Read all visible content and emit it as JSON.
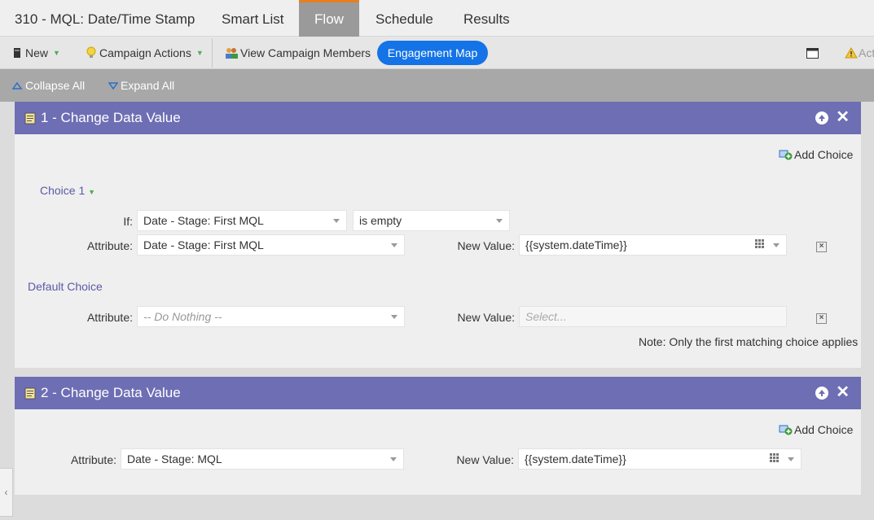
{
  "tabs": [
    {
      "label": "310 - MQL: Date/Time Stamp"
    },
    {
      "label": "Smart List"
    },
    {
      "label": "Flow"
    },
    {
      "label": "Schedule"
    },
    {
      "label": "Results"
    }
  ],
  "toolbar": {
    "new_label": "New",
    "campaign_actions_label": "Campaign Actions",
    "view_members_label": "View Campaign Members",
    "engagement_map_label": "Engagement Map",
    "right_truncated_label": "Act"
  },
  "collapse": {
    "collapse_all": "Collapse All",
    "expand_all": "Expand All"
  },
  "flow_steps": [
    {
      "title": "1 - Change Data Value",
      "add_choice": "Add Choice",
      "choice_label": "Choice 1",
      "if_label": "If:",
      "if_field": "Date - Stage: First MQL",
      "if_operator": "is empty",
      "attribute_label": "Attribute:",
      "attribute_value": "Date - Stage: First MQL",
      "new_value_label": "New Value:",
      "new_value": "{{system.dateTime}}",
      "default_choice_label": "Default Choice",
      "default_attribute_label": "Attribute:",
      "default_attribute_value": "-- Do Nothing --",
      "default_new_value_label": "New Value:",
      "default_new_value_placeholder": "Select...",
      "note": "Note: Only the first matching choice applies"
    },
    {
      "title": "2 - Change Data Value",
      "add_choice": "Add Choice",
      "attribute_label": "Attribute:",
      "attribute_value": "Date - Stage: MQL",
      "new_value_label": "New Value:",
      "new_value": "{{system.dateTime}}"
    }
  ],
  "colors": {
    "header_purple": "#6e6eb4",
    "accent_blue": "#1473e6",
    "active_tab_border": "#e67e22",
    "choice_purple": "#5a5aa8"
  }
}
